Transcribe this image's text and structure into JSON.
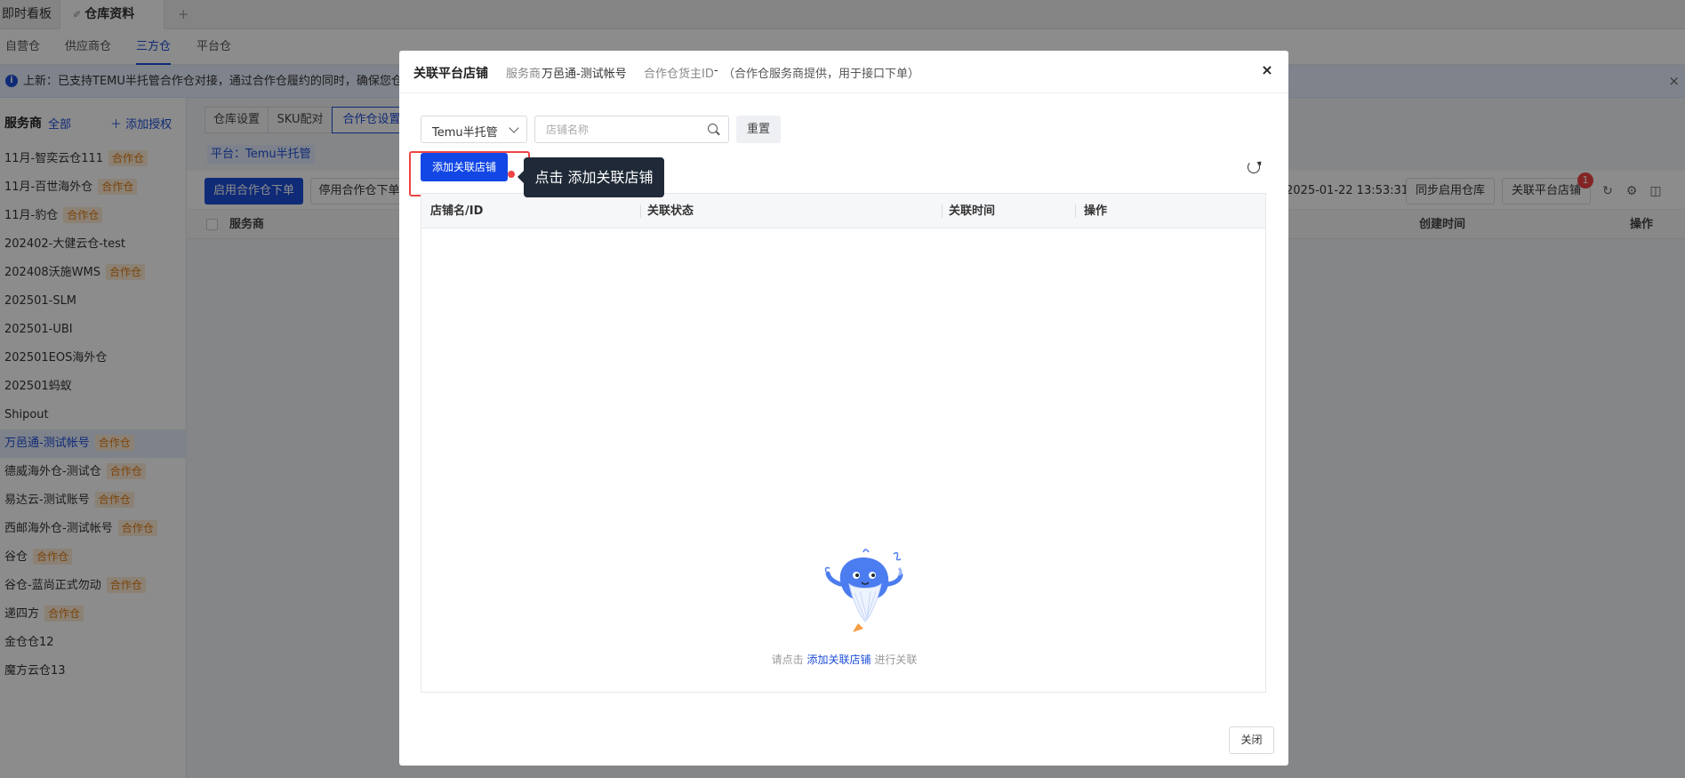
{
  "window_tabs": {
    "tab1": "即时看板",
    "tab2": "仓库资料",
    "add": "+"
  },
  "subtabs": [
    "自营仓",
    "供应商仓",
    "三方仓",
    "平台仓"
  ],
  "notice": {
    "text": "上新：已支持TEMU半托管合作仓对接，通过合作仓履约的同时，确保您仓库仓",
    "close": "×"
  },
  "sidebar": {
    "title": "服务商",
    "all": "全部",
    "add_auth": "＋ 添加授权",
    "items": [
      {
        "label": "11月-智奕云仓111",
        "tag": "合作仓"
      },
      {
        "label": "11月-百世海外仓",
        "tag": "合作仓"
      },
      {
        "label": "11月-豹仓",
        "tag": "合作仓"
      },
      {
        "label": "202402-大健云仓-test",
        "tag": ""
      },
      {
        "label": "202408沃施WMS",
        "tag": "合作仓"
      },
      {
        "label": "202501-SLM",
        "tag": ""
      },
      {
        "label": "202501-UBI",
        "tag": ""
      },
      {
        "label": "202501EOS海外仓",
        "tag": ""
      },
      {
        "label": "202501蚂蚁",
        "tag": ""
      },
      {
        "label": "Shipout",
        "tag": ""
      },
      {
        "label": "万邑通-测试帐号",
        "tag": "合作仓"
      },
      {
        "label": "德威海外仓-测试仓",
        "tag": "合作仓"
      },
      {
        "label": "易达云-测试账号",
        "tag": "合作仓"
      },
      {
        "label": "西邮海外仓-测试帐号",
        "tag": "合作仓"
      },
      {
        "label": "谷仓",
        "tag": "合作仓"
      },
      {
        "label": "谷仓-蓝尚正式勿动",
        "tag": "合作仓"
      },
      {
        "label": "递四方",
        "tag": "合作仓"
      },
      {
        "label": "金仓仓12",
        "tag": ""
      },
      {
        "label": "魔方云仓13",
        "tag": ""
      }
    ]
  },
  "content": {
    "tabs": [
      "仓库设置",
      "SKU配对",
      "合作仓设置"
    ],
    "platform_filter": "平台：Temu半托管",
    "enable_btn": "启用合作仓下单",
    "disable_btn": "停用合作仓下单",
    "timestamp": "2025-01-22 13:53:31",
    "sync_btn": "同步启用仓库",
    "link_btn": "关联平台店铺",
    "link_badge": "1",
    "columns": {
      "provider": "服务商",
      "created": "创建时间",
      "action": "操作"
    }
  },
  "modal": {
    "title": "关联平台店铺",
    "provider_label": "服务商",
    "provider_value": "万邑通-测试帐号",
    "owner_label": "合作仓货主ID",
    "owner_value": "-",
    "owner_note": "（合作仓服务商提供，用于接口下单）",
    "close_x": "×",
    "platform_select": "Temu半托管",
    "search_placeholder": "店铺名称",
    "reset": "重置",
    "add_store": "添加关联店铺",
    "columns": {
      "name": "店铺名/ID",
      "status": "关联状态",
      "time": "关联时间",
      "action": "操作"
    },
    "tooltip": "点击 添加关联店铺",
    "empty_prefix": "请点击",
    "empty_link": "添加关联店铺",
    "empty_suffix": "进行关联",
    "close_btn": "关闭"
  }
}
